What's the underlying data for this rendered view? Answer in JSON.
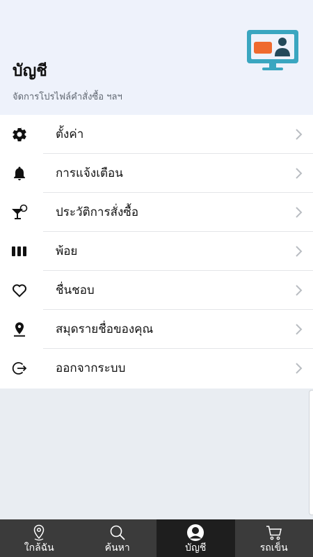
{
  "header": {
    "title": "บัญชี",
    "subtitle": "จัดการโปรไฟล์คำสั่งซื้อ ฯลฯ",
    "illustration_icon": "presentation-monitor-icon"
  },
  "menu": {
    "items": [
      {
        "label": "ตั้งค่า",
        "icon": "gear-icon"
      },
      {
        "label": "การแจ้งเตือน",
        "icon": "bell-icon"
      },
      {
        "label": "ประวัติการสั่งซื้อ",
        "icon": "cocktail-history-icon"
      },
      {
        "label": "พ้อย",
        "icon": "points-bars-icon"
      },
      {
        "label": "ชื่นชอบ",
        "icon": "heart-icon"
      },
      {
        "label": "สมุดรายชื่อของคุณ",
        "icon": "location-pin-icon"
      },
      {
        "label": "ออกจากระบบ",
        "icon": "logout-icon"
      }
    ]
  },
  "tabbar": {
    "tabs": [
      {
        "label": "ใกล้ฉัน",
        "icon": "location-pin-icon",
        "active": false
      },
      {
        "label": "ค้นหา",
        "icon": "search-icon",
        "active": false
      },
      {
        "label": "บัญชี",
        "icon": "user-icon",
        "active": true
      },
      {
        "label": "รถเข็น",
        "icon": "cart-icon",
        "active": false
      }
    ]
  },
  "colors": {
    "header_bg": "#eef2fb",
    "page_bg": "#e9edf2",
    "tabbar_bg": "#3b3b3b",
    "tab_active_bg": "#1e1e1e",
    "illustration_teal": "#3aa6c0",
    "illustration_orange": "#ef6a2e"
  }
}
